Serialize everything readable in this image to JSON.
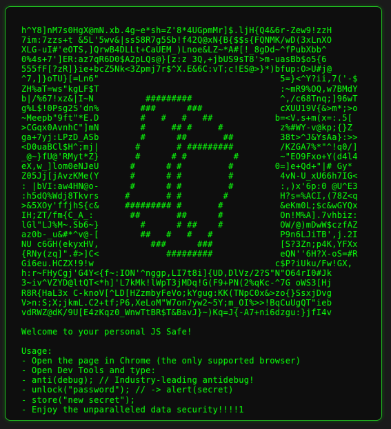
{
  "colors": {
    "page_background": "#1a1a1a",
    "terminal_background": "#0e0e0e",
    "text": "#0cf00c",
    "border": "#21c021"
  },
  "banner": {
    "lines": [
      "h^Y8]nM7s0HgX@mN.xb.4g~e*sh=Z'8*4UGpmMr]$.ljH{Q4&6r-Zew9!zzH",
      "7im:7zzs+t &5L'5wv&|ssS8R7g5Sb!f42Q@xN{B{$$s{FQNMK/wD(3xLnXO",
      "XLG-uI#'eOTS,]QrwB4DLLt+CaUEM_)Lnoe&LZ~*A#[!_8gDd~^fPubXbb^",
      "0%4s+7']ER:az7qR6D0$A2pLQs@}[z:z 3Q,+jbUS9sT8'>m-uasBb$o5{6",
      "555fF[?zR]}ie+bcZ5Nk<3Zpmj7r$^X.E&6C:vT;c!ES@>}*)bfup:O>U#j@",
      "^7,]}oTU}[=Ln6\"                                   5=}<^Y?ii,7('-$",
      "ZH%aT=ws\"kgLF$T                                   :~mR9%OQ,w7BMdY",
      "b|/%67!xz&|I~N          #########                 ^,/c68Tnq;]96wT",
      "g%L$!0Psg2S'dn%        ###      ###               cXUU19V{&>m*;>o",
      "~Meepb\"9ft\"*E.D        #   #   #   ##            b=<V.s+m(x=:.5[",
      ">CGqx0AvnhC\"]mN        #     ## #     #           z%#WY-v@kp;{}Z",
      "ga+7yj:LPzD_ASb        #      ##       ##         38t>^J&YsAa}:>>",
      "<D0uaBCl$H^;mj|       #       # #########         /KZGA7%*\"^!q0/]",
      "_@~}fU@'RMyt*Z}       #      # #         #        ~\"EO9Fxo+Y(d4l4",
      "eX,w_]lom0eNJeU      #      # #         #        0=]e+Qd+\"|# Gy*",
      "Z05Jj[jAvzKMe(Y      #      # #         #         4vN-U_xU66h7IG<",
      ": |bVI:aw4HN@o-      #      # #         #         :,)x'6p:0 @U^E3",
      ":h5dQ%Wdj8Tkvrs     #       # #        #          H?s=%ACI,(78Z<q",
      ">&5XOy'ffjhS{c&     ######### #       #           &eKm0L;$c&wGYQx",
      "IH;ZT/fm{C_A_:       ##       ##      #           On!M%A].7vhbiz:",
      "lGl\"LJ%M~.Sb6~}        #      # ##    #           OW/@)mDwW$czfAZ",
      "az0b-_u&#*^v@-[        ##   #   #   #             P9n6LJiTB',j.2I",
      "NU c6GH(ekyxHV,          ###      ###             [S?3Zn;p4K,YFXx",
      "{RNy(zq]\".#>]C<             #########             eQN''6H?X-oS=#R",
      "Gi6eu.HCZX!9!w                                   c$P?iUku/Fw!GX,",
      "h:r~FHyCgj'G4Y<{f~:ION'^nggp,LI7t8i]{UD,DlVz/2?S\"N\"O64rI0#Jk",
      "3~iv^VZYD@ltQT<*h]'L7kMk!lWpT3jMDq!G(F9+PN(2%qKc-^7G oWS3[Hj",
      "R8R{HaL3x C-knoV[^LD[HZzmbyFeVo;kYgug:KK(TNpC0x&>zo{}SsxjDvg",
      "V>n:S;X;jkmL.C2+tf;P6,XeLoM\"W7on7yw2~5Y;m_OI%>>!BqCuUgQT\"ieb",
      "vdRWZ@dK/9U[E4zKqz0_WnwTtBR$T&BavJ}~)Kq=J{-A7+ni6dzgu:}jfI4v"
    ]
  },
  "welcome": "Welcome to your personal JS Safe!",
  "usage": {
    "heading": "Usage:",
    "items": [
      "- Open the page in Chrome (the only supported browser)",
      "- Open Dev Tools and type:",
      "- anti(debug); // Industry-leading antidebug!",
      "- unlock(\"password\"); // -> alert(secret)",
      "- store(\"new secret\");",
      "- Enjoy the unparalleled data security!!!!1"
    ]
  }
}
